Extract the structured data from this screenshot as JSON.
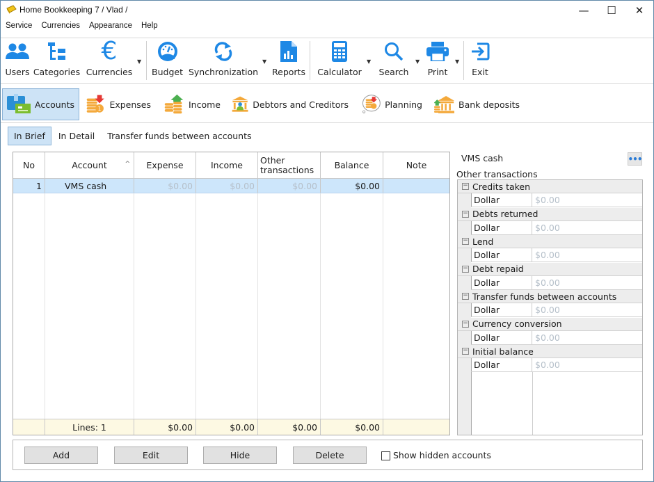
{
  "window": {
    "title": "Home Bookkeeping 7  / Vlad /",
    "controls": {
      "minimize": "—",
      "maximize": "☐",
      "close": "✕"
    }
  },
  "menu": [
    "Service",
    "Currencies",
    "Appearance",
    "Help"
  ],
  "toolbar": {
    "buttons": [
      {
        "label": "Users",
        "icon": "users-icon",
        "dropdown": false
      },
      {
        "label": "Categories",
        "icon": "categories-icon",
        "dropdown": false
      },
      {
        "label": "Currencies",
        "icon": "euro-icon",
        "dropdown": true
      },
      {
        "label": "Budget",
        "icon": "gauge-icon",
        "dropdown": false
      },
      {
        "label": "Synchronization",
        "icon": "sync-icon",
        "dropdown": true
      },
      {
        "label": "Reports",
        "icon": "report-icon",
        "dropdown": false
      },
      {
        "label": "Calculator",
        "icon": "calculator-icon",
        "dropdown": true
      },
      {
        "label": "Search",
        "icon": "search-icon",
        "dropdown": true
      },
      {
        "label": "Print",
        "icon": "printer-icon",
        "dropdown": true
      },
      {
        "label": "Exit",
        "icon": "exit-icon",
        "dropdown": false
      }
    ],
    "icon_color": "#1e88e5"
  },
  "sections": [
    {
      "label": "Accounts",
      "active": true
    },
    {
      "label": "Expenses",
      "active": false
    },
    {
      "label": "Income",
      "active": false
    },
    {
      "label": "Debtors and Creditors",
      "active": false
    },
    {
      "label": "Planning",
      "active": false
    },
    {
      "label": "Bank deposits",
      "active": false
    }
  ],
  "subtabs": [
    {
      "label": "In Brief",
      "active": true
    },
    {
      "label": "In Detail",
      "active": false
    },
    {
      "label": "Transfer funds between accounts",
      "active": false
    }
  ],
  "grid": {
    "columns": [
      "No",
      "Account",
      "Expense",
      "Income",
      "Other transactions",
      "Balance",
      "Note"
    ],
    "column_lines": {
      "other_1": "Other",
      "other_2": "transactions"
    },
    "sort_indicator": "^",
    "rows": [
      {
        "no": "1",
        "account": "VMS cash",
        "expense": "$0.00",
        "income": "$0.00",
        "other": "$0.00",
        "balance": "$0.00",
        "note": ""
      }
    ],
    "footer": {
      "lines": "Lines: 1",
      "expense": "$0.00",
      "income": "$0.00",
      "other": "$0.00",
      "balance": "$0.00"
    }
  },
  "details": {
    "title": "VMS cash",
    "more_button": "•••",
    "section_label": "Other transactions",
    "groups": [
      {
        "name": "Credits taken",
        "currency": "Dollar",
        "value": "$0.00"
      },
      {
        "name": "Debts returned",
        "currency": "Dollar",
        "value": "$0.00"
      },
      {
        "name": "Lend",
        "currency": "Dollar",
        "value": "$0.00"
      },
      {
        "name": "Debt repaid",
        "currency": "Dollar",
        "value": "$0.00"
      },
      {
        "name": "Transfer funds between accounts",
        "currency": "Dollar",
        "value": "$0.00"
      },
      {
        "name": "Currency conversion",
        "currency": "Dollar",
        "value": "$0.00"
      },
      {
        "name": "Initial balance",
        "currency": "Dollar",
        "value": "$0.00"
      }
    ]
  },
  "actions": {
    "add": "Add",
    "edit": "Edit",
    "hide": "Hide",
    "delete": "Delete",
    "show_hidden_label": "Show hidden accounts",
    "show_hidden_checked": false
  }
}
